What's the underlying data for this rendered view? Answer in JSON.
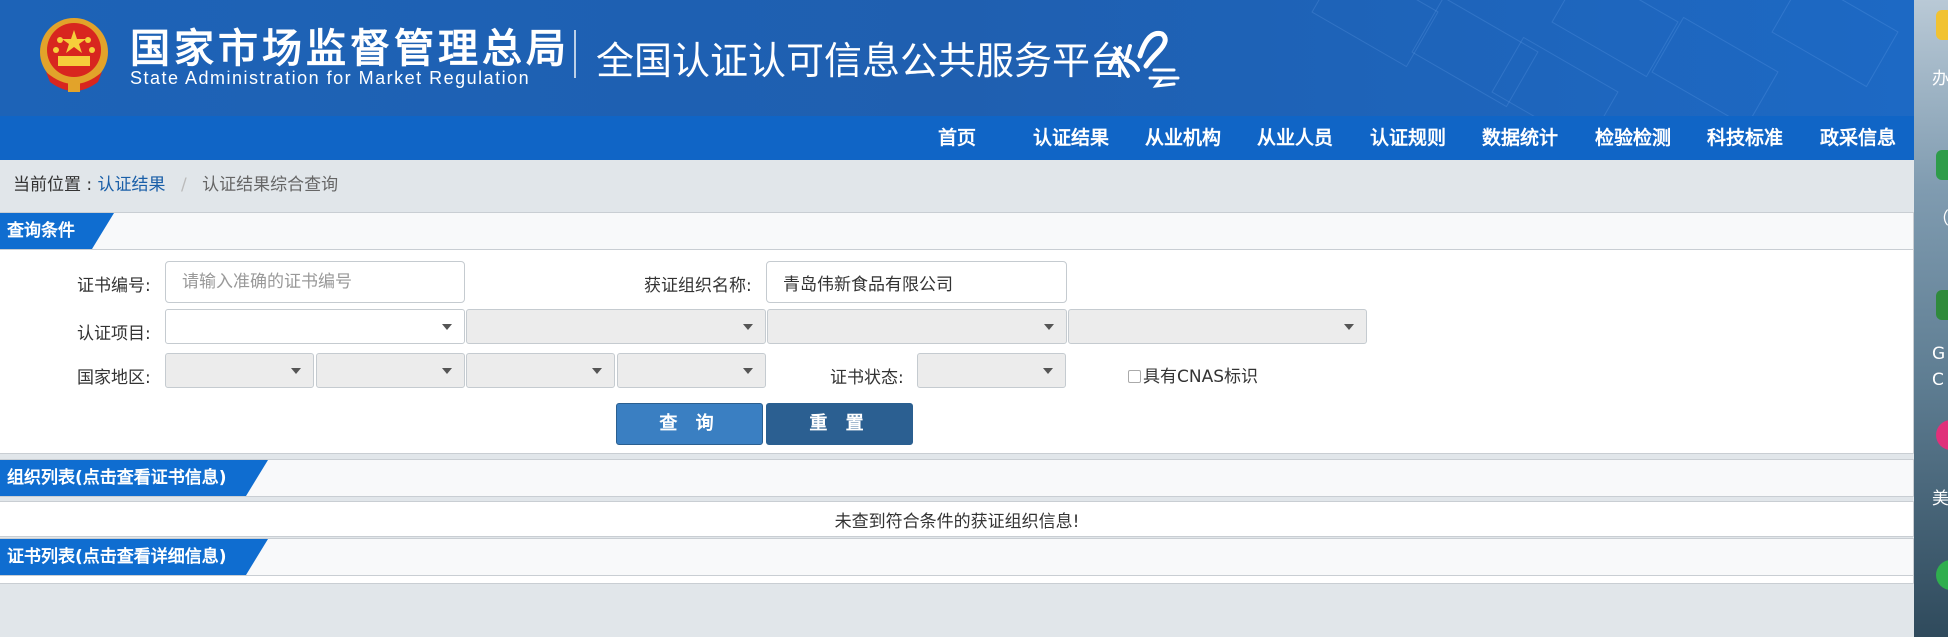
{
  "header": {
    "org_cn": "国家市场监督管理总局",
    "org_en": "State Administration  for  Market Regulation",
    "platform": "全国认证认可信息公共服务平台",
    "colors": {
      "header_bg": "#1d63b7",
      "nav_bg": "#1065c6",
      "tag_bg": "#0f6dd0"
    }
  },
  "nav": [
    "首页",
    "认证结果",
    "从业机构",
    "从业人员",
    "认证规则",
    "数据统计",
    "检验检测",
    "科技标准",
    "政采信息"
  ],
  "breadcrumb": {
    "prefix": "当前位置 :",
    "link": "认证结果",
    "separator": "/",
    "current": "认证结果综合查询"
  },
  "query_panel": {
    "title": "查询条件",
    "cert_no_label": "证书编号:",
    "cert_no_placeholder": "请输入准确的证书编号",
    "org_name_label": "获证组织名称:",
    "org_name_value": "青岛伟新食品有限公司",
    "project_label": "认证项目:",
    "region_label": "国家地区:",
    "status_label": "证书状态:",
    "cnas_label": "具有CNAS标识",
    "query_button": "查 询",
    "reset_button": "重 置"
  },
  "org_list": {
    "title": "组织列表(点击查看证书信息)",
    "empty_message": "未查到符合条件的获证组织信息!"
  },
  "cert_list": {
    "title": "证书列表(点击查看详细信息)"
  },
  "desktop_strip": {
    "texts": [
      "办",
      "（花",
      "G",
      "C",
      "美"
    ]
  }
}
